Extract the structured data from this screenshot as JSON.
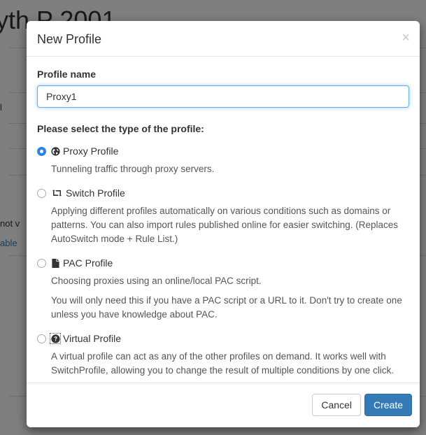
{
  "background": {
    "title_fragment": "yth    P      2001",
    "left_text_1": "l",
    "left_text_2": "not v",
    "left_link": "able"
  },
  "modal": {
    "title": "New Profile",
    "close_symbol": "×",
    "name_label": "Profile name",
    "name_value": "Proxy1",
    "type_label": "Please select the type of the profile:",
    "options": [
      {
        "icon": "globe-icon",
        "label": "Proxy Profile",
        "checked": true,
        "help": [
          "Tunneling traffic through proxy servers."
        ]
      },
      {
        "icon": "retweet-icon",
        "label": "Switch Profile",
        "checked": false,
        "help": [
          "Applying different profiles automatically on various conditions such as domains or patterns. You can also import rules published online for easier switching. (Replaces AutoSwitch mode + Rule List.)"
        ]
      },
      {
        "icon": "file-icon",
        "label": "PAC Profile",
        "checked": false,
        "help": [
          "Choosing proxies using an online/local PAC script.",
          "You will only need this if you have a PAC script or a URL to it. Don't try to create one unless you have knowledge about PAC."
        ]
      },
      {
        "icon": "question-circle-icon",
        "label": "Virtual Profile",
        "checked": false,
        "help": [
          "A virtual profile can act as any of the other profiles on demand. It works well with SwitchProfile, allowing you to change the result of multiple conditions by one click."
        ]
      }
    ],
    "cancel_label": "Cancel",
    "create_label": "Create"
  },
  "colors": {
    "primary": "#337ab7",
    "radio_checked": "#2f82e6",
    "focus_border": "#66afe9"
  }
}
